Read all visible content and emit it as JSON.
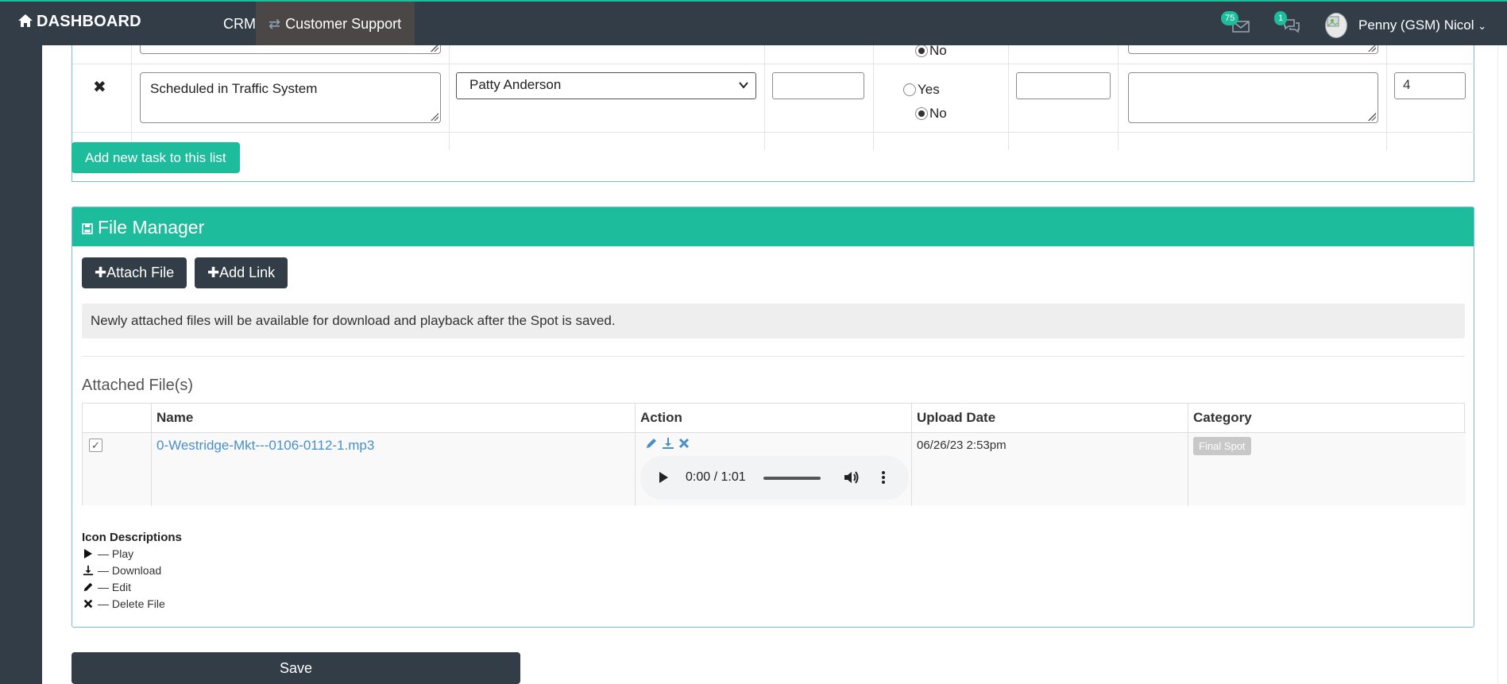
{
  "nav": {
    "brand": "DASHBOARD",
    "crm": "CRM",
    "customer_support": "Customer Support",
    "messages_count": "75",
    "chat_count": "1",
    "user_name": "Penny (GSM) Nicol"
  },
  "tasks": {
    "row_prev": {
      "complete_no": "No"
    },
    "row": {
      "task_text": "Scheduled in Traffic System",
      "assignee": "Patty Anderson",
      "complete_yes": "Yes",
      "complete_no": "No",
      "order": "4"
    },
    "add_button": "Add new task to this list"
  },
  "file_manager": {
    "title": "File Manager",
    "attach_file": "Attach File",
    "add_link": "Add Link",
    "notice": "Newly attached files will be available for download and playback after the Spot is saved.",
    "attached_title": "Attached File(s)",
    "columns": [
      "Name",
      "Action",
      "Upload Date",
      "Category"
    ],
    "files": [
      {
        "name": "0-Westridge-Mkt---0106-0112-1.mp3",
        "audio_time": "0:00 / 1:01",
        "upload_date": "06/26/23 2:53pm",
        "category": "Final Spot"
      }
    ],
    "icon_desc_title": "Icon Descriptions",
    "icon_desc": [
      "— Play",
      "— Download",
      "— Edit",
      "— Delete File"
    ]
  },
  "save_label": "Save",
  "colors": {
    "accent": "#1cbc9c",
    "nav": "#333d48",
    "link": "#4a8fc7"
  }
}
